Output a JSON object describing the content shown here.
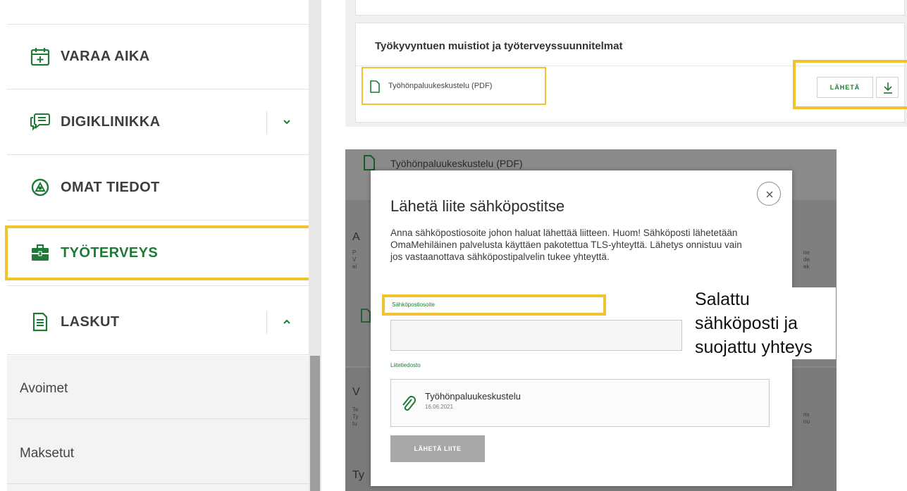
{
  "sidebar": {
    "items": [
      {
        "label": "VARAA AIKA",
        "icon": "calendar-plus-icon"
      },
      {
        "label": "DIGIKLINIKKA",
        "icon": "chat-bubbles-icon",
        "chevron": "down"
      },
      {
        "label": "OMAT TIEDOT",
        "icon": "person-circle-icon"
      },
      {
        "label": "TYÖTERVEYS",
        "icon": "briefcase-icon",
        "active": true
      },
      {
        "label": "LASKUT",
        "icon": "invoice-icon",
        "chevron": "up"
      }
    ],
    "sub_items": [
      {
        "label": "Avoimet"
      },
      {
        "label": "Maksetut"
      }
    ]
  },
  "card": {
    "title": "Työkyvyntuen muistiot ja työterveyssuunnitelmat",
    "file_name": "Työhönpaluukeskustelu (PDF)",
    "send_label": "LÄHETÄ",
    "download_icon": "download-icon"
  },
  "modal_screenshot": {
    "background_file_name": "Työhönpaluukeskustelu (PDF)",
    "title": "Lähetä liite sähköpostitse",
    "description": "Anna sähköpostiosoite johon haluat lähettää liitteen. Huom! Sähköposti lähetetään OmaMehiläinen palvelusta käyttäen pakotettua TLS-yhteyttä. Lähetys onnistuu vain jos vastaanottava sähköpostipalvelin tukee yhteyttä.",
    "email_label": "Sähköpostiosoite",
    "email_value": "",
    "attachment_label": "Liitetiedosto",
    "attachment_name": "Työhönpaluukeskustelu",
    "attachment_date": "16.06.2021",
    "send_button": "LÄHETÄ LIITE"
  },
  "annotation": {
    "line1": "Salattu",
    "line2": "sähköposti ja",
    "line3": "suojattu yhteys"
  },
  "colors": {
    "brand_green": "#1f7a36",
    "highlight_yellow": "#f2c130"
  }
}
